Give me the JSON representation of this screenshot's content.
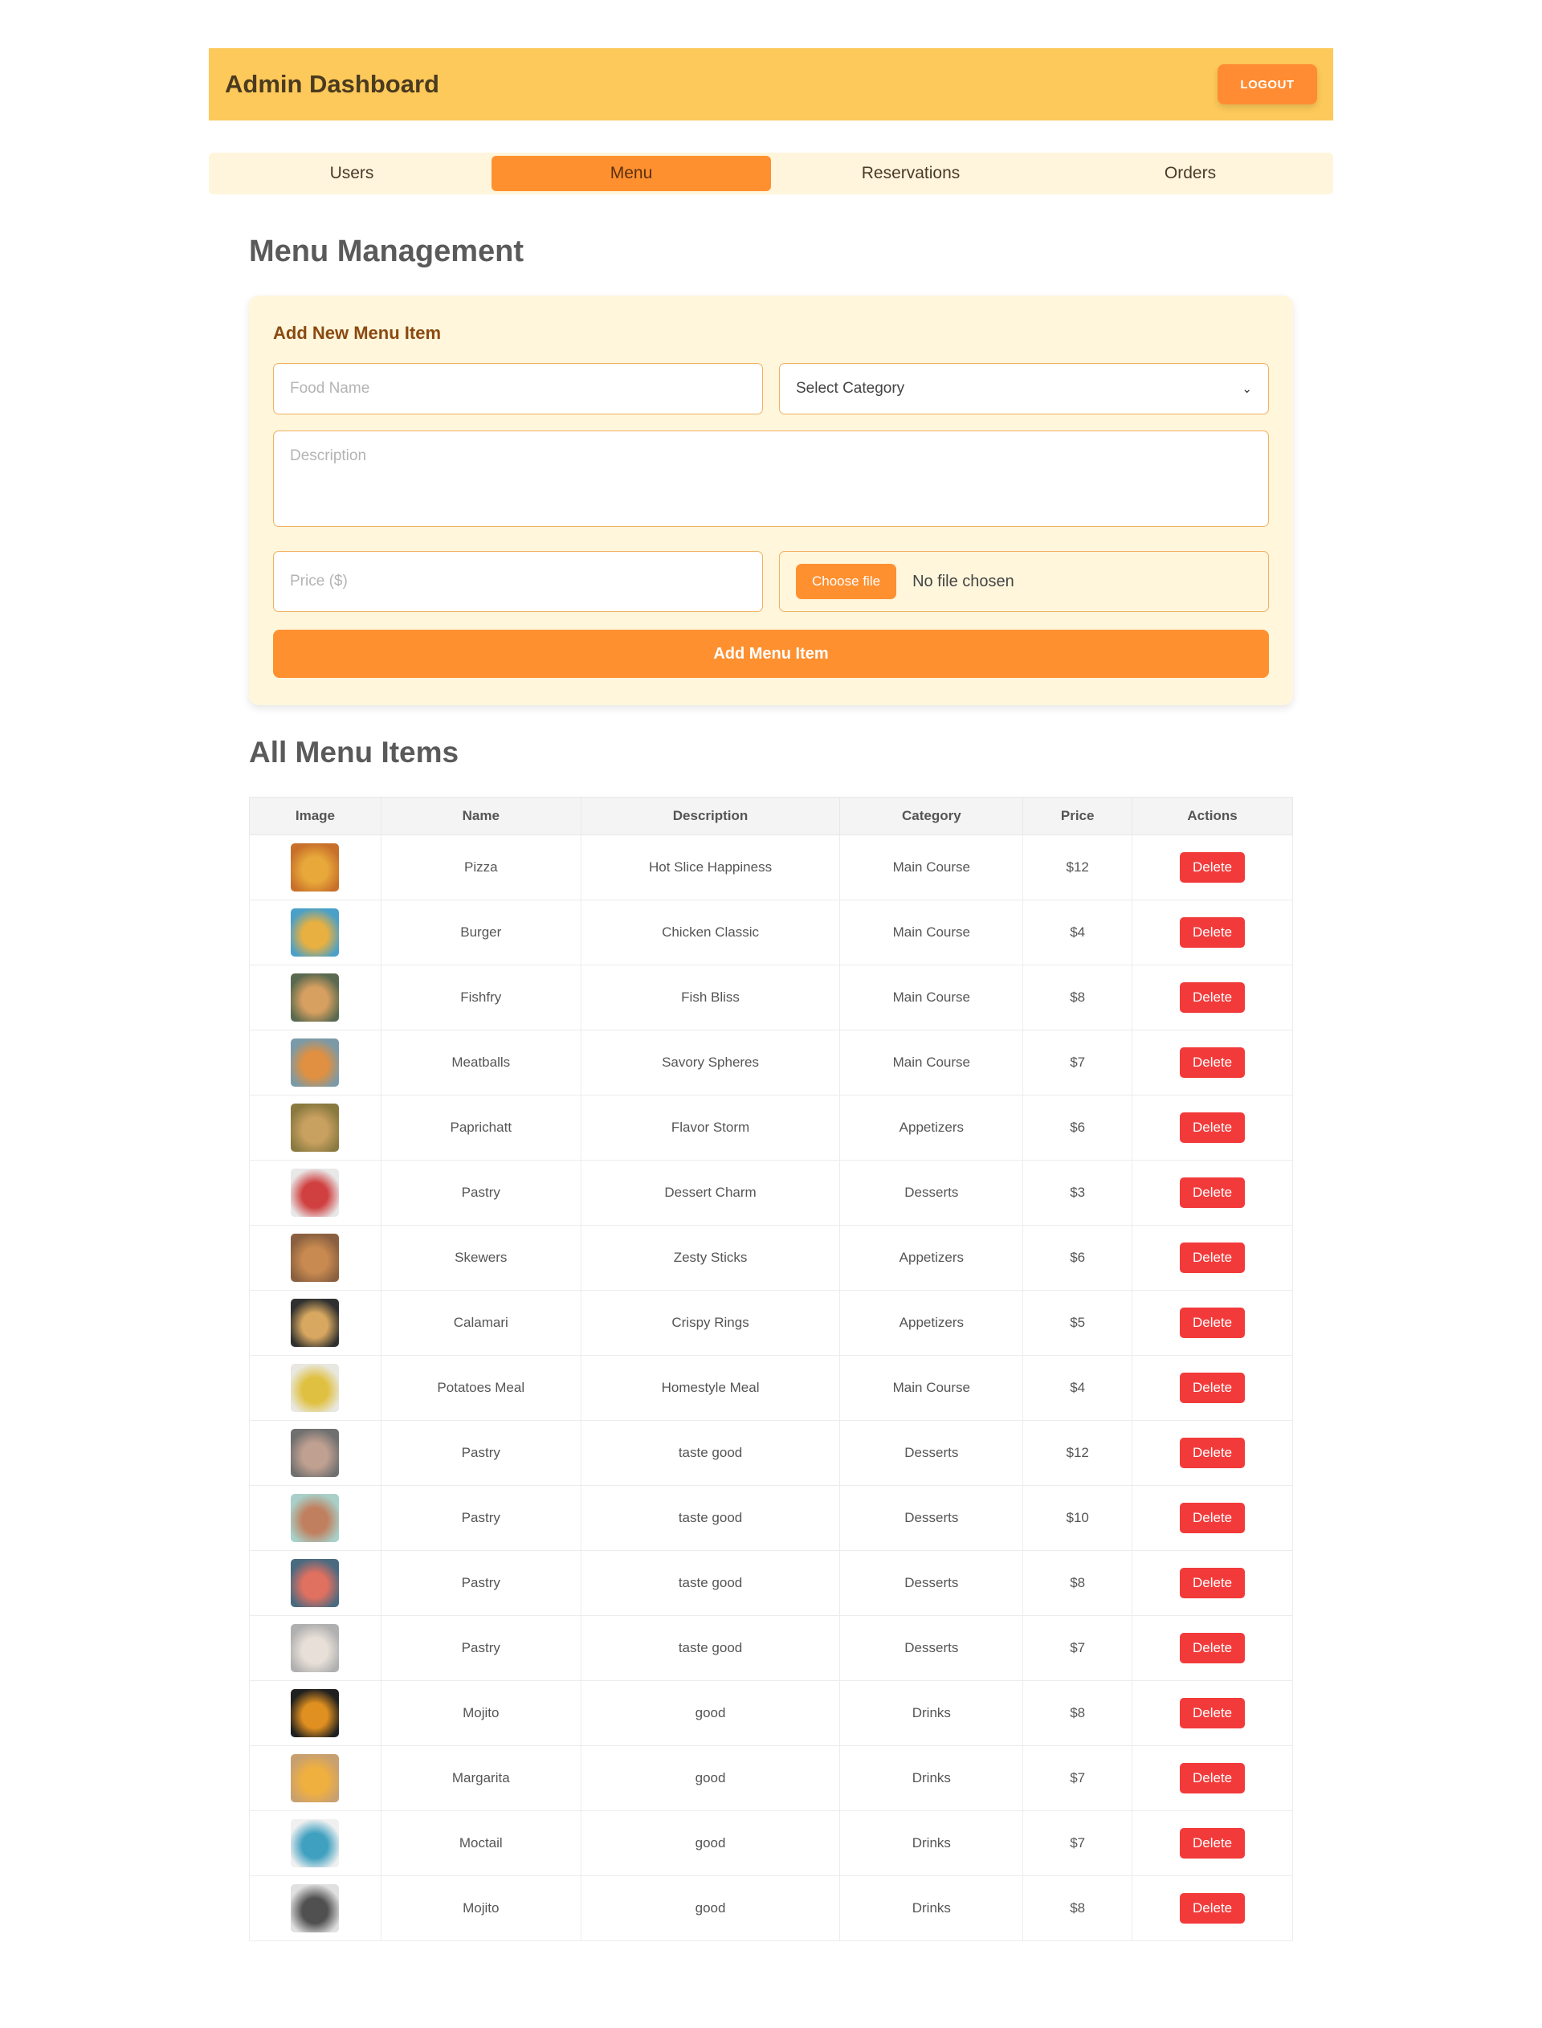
{
  "header": {
    "title": "Admin Dashboard",
    "logout_label": "LOGOUT"
  },
  "tabs": [
    {
      "label": "Users",
      "active": false
    },
    {
      "label": "Menu",
      "active": true
    },
    {
      "label": "Reservations",
      "active": false
    },
    {
      "label": "Orders",
      "active": false
    }
  ],
  "page_title": "Menu Management",
  "form": {
    "title": "Add New Menu Item",
    "food_name_placeholder": "Food Name",
    "category_select_value": "Select Category",
    "description_placeholder": "Description",
    "price_placeholder": "Price ($)",
    "choose_file_label": "Choose file",
    "file_status": "No file chosen",
    "submit_label": "Add Menu Item"
  },
  "table": {
    "title": "All Menu Items",
    "columns": [
      "Image",
      "Name",
      "Description",
      "Category",
      "Price",
      "Actions"
    ],
    "delete_label": "Delete",
    "rows": [
      {
        "name": "Pizza",
        "description": "Hot Slice Happiness",
        "category": "Main Course",
        "price": "$12",
        "thumb_colors": [
          "#c8702a",
          "#e8a83a"
        ]
      },
      {
        "name": "Burger",
        "description": "Chicken Classic",
        "category": "Main Course",
        "price": "$4",
        "thumb_colors": [
          "#4aa0c8",
          "#e8b040"
        ]
      },
      {
        "name": "Fishfry",
        "description": "Fish Bliss",
        "category": "Main Course",
        "price": "$8",
        "thumb_colors": [
          "#5a6a50",
          "#d8a060"
        ]
      },
      {
        "name": "Meatballs",
        "description": "Savory Spheres",
        "category": "Main Course",
        "price": "$7",
        "thumb_colors": [
          "#7a9aa8",
          "#e09040"
        ]
      },
      {
        "name": "Paprichatt",
        "description": "Flavor Storm",
        "category": "Appetizers",
        "price": "$6",
        "thumb_colors": [
          "#8a7a40",
          "#c8a060"
        ]
      },
      {
        "name": "Pastry",
        "description": "Dessert Charm",
        "category": "Desserts",
        "price": "$3",
        "thumb_colors": [
          "#e8e8e8",
          "#d04040"
        ]
      },
      {
        "name": "Skewers",
        "description": "Zesty Sticks",
        "category": "Appetizers",
        "price": "$6",
        "thumb_colors": [
          "#8a6040",
          "#c88a50"
        ]
      },
      {
        "name": "Calamari",
        "description": "Crispy Rings",
        "category": "Appetizers",
        "price": "$5",
        "thumb_colors": [
          "#303030",
          "#d8a860"
        ]
      },
      {
        "name": "Potatoes Meal",
        "description": "Homestyle Meal",
        "category": "Main Course",
        "price": "$4",
        "thumb_colors": [
          "#e8e8e0",
          "#e0c040"
        ]
      },
      {
        "name": "Pastry",
        "description": "taste good",
        "category": "Desserts",
        "price": "$12",
        "thumb_colors": [
          "#707070",
          "#c0a090"
        ]
      },
      {
        "name": "Pastry",
        "description": "taste good",
        "category": "Desserts",
        "price": "$10",
        "thumb_colors": [
          "#a8d0c8",
          "#c08060"
        ]
      },
      {
        "name": "Pastry",
        "description": "taste good",
        "category": "Desserts",
        "price": "$8",
        "thumb_colors": [
          "#4a6a80",
          "#e07060"
        ]
      },
      {
        "name": "Pastry",
        "description": "taste good",
        "category": "Desserts",
        "price": "$7",
        "thumb_colors": [
          "#b0b0b0",
          "#e8e0d8"
        ]
      },
      {
        "name": "Mojito",
        "description": "good",
        "category": "Drinks",
        "price": "$8",
        "thumb_colors": [
          "#202020",
          "#e09020"
        ]
      },
      {
        "name": "Margarita",
        "description": "good",
        "category": "Drinks",
        "price": "$7",
        "thumb_colors": [
          "#c8a070",
          "#f0b040"
        ]
      },
      {
        "name": "Moctail",
        "description": "good",
        "category": "Drinks",
        "price": "$7",
        "thumb_colors": [
          "#f0f0f0",
          "#40a0c0"
        ]
      },
      {
        "name": "Mojito",
        "description": "good",
        "category": "Drinks",
        "price": "$8",
        "thumb_colors": [
          "#e0e0e0",
          "#505050"
        ]
      }
    ]
  },
  "colors": {
    "header_bg": "#fdc95a",
    "accent_orange": "#ff9030",
    "card_bg": "#fff6dc",
    "delete_red": "#f23a3a"
  }
}
